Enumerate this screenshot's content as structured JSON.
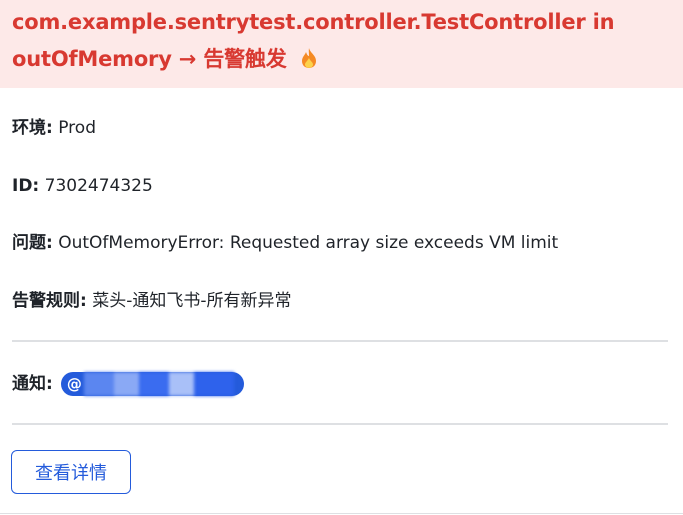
{
  "header": {
    "title_line1": "com.example.sentrytest.controller.TestController in",
    "title_line2": "outOfMemory → 告警触发",
    "title_icon": "fire-icon",
    "bg_color": "#fde9e8",
    "text_color": "#d83931"
  },
  "fields": {
    "env_label": "环境:",
    "env_value": "Prod",
    "id_label": "ID:",
    "id_value": "7302474325",
    "issue_label": "问题:",
    "issue_value": "OutOfMemoryError: Requested array size exceeds VM limit",
    "rule_label": "告警规则:",
    "rule_value": "菜头-通知飞书-所有新异常"
  },
  "notify": {
    "label": "通知:",
    "mention_prefix": "@",
    "mention_color": "#245bdb"
  },
  "actions": {
    "view_details_label": "查看详情"
  }
}
